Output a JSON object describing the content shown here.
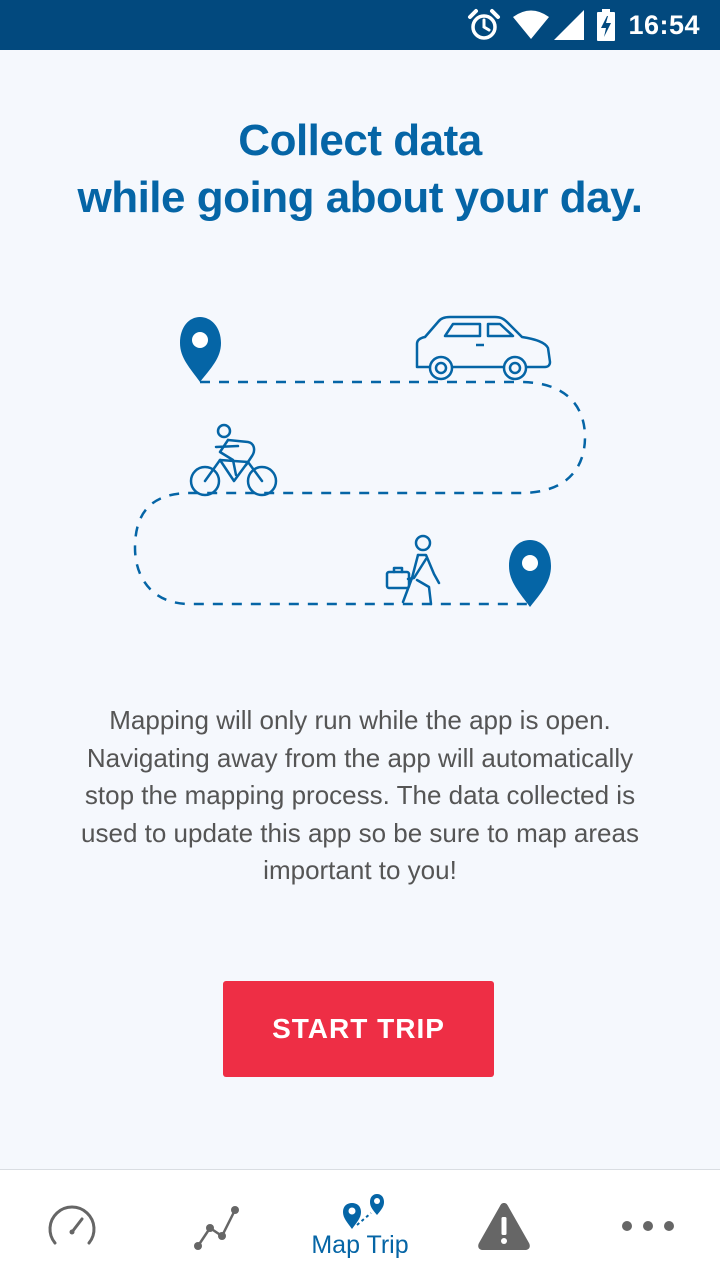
{
  "status_bar": {
    "time": "16:54",
    "icons": [
      "alarm-icon",
      "wifi-icon",
      "signal-icon",
      "battery-charging-icon"
    ]
  },
  "headline": {
    "line1": "Collect data",
    "line2": "while going about your day."
  },
  "illustration": {
    "icons": [
      "map-pin-icon",
      "car-icon",
      "cyclist-icon",
      "walking-person-icon",
      "map-pin-icon"
    ],
    "color": "#0565a6"
  },
  "description": {
    "line1": "Mapping will only run while the app is open.",
    "line2": "Navigating away from the app will automatically",
    "line3": "stop the mapping process. The data collected is",
    "line4": "used to update this app so be sure to map areas",
    "line5": "important to you!"
  },
  "start_button": {
    "label": "START TRIP",
    "color": "#ee2e45"
  },
  "nav": {
    "items": [
      {
        "icon": "speedometer-icon",
        "label": ""
      },
      {
        "icon": "line-graph-icon",
        "label": ""
      },
      {
        "icon": "map-trip-icon",
        "label": "Map Trip",
        "active": true
      },
      {
        "icon": "warning-icon",
        "label": ""
      },
      {
        "icon": "more-icon",
        "label": ""
      }
    ]
  },
  "colors": {
    "status_bar": "#02497e",
    "accent": "#0565a6",
    "background": "#f5f8fd",
    "text": "#555555",
    "nav_inactive": "#666666"
  }
}
